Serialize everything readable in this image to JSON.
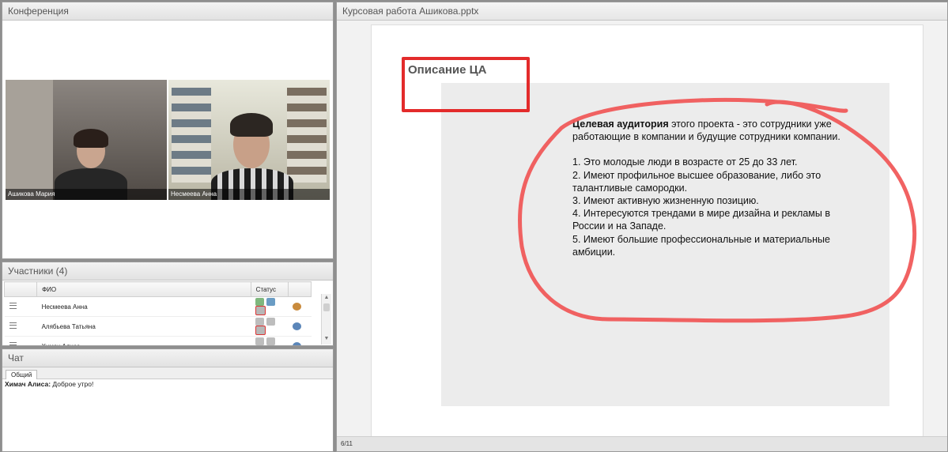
{
  "conference": {
    "title": "Конференция",
    "videos": [
      {
        "name": "Ашикова Мария"
      },
      {
        "name": "Несмеева Анна"
      }
    ]
  },
  "participants": {
    "title": "Участники (4)",
    "columns": {
      "name": "ФИО",
      "status": "Статус"
    },
    "rows": [
      {
        "name": "Несмеева Анна"
      },
      {
        "name": "Алябьева Татьяна"
      },
      {
        "name": "Химач Алиса"
      }
    ]
  },
  "chat": {
    "title": "Чат",
    "tab": "Общий",
    "messages": [
      {
        "user": "Химач Алиса:",
        "text": " Доброе утро!"
      }
    ]
  },
  "presentation": {
    "title": "Курсовая  работа Ашикова.pptx",
    "slide_title": "Описание  ЦА",
    "intro_bold": "Целевая аудитория",
    "intro_rest": " этого проекта  - это сотрудники  уже работающие  в компании  и будущие  сотрудники  компании.",
    "points": [
      "1. Это молодые люди  в возрасте от 25 до 33 лет.",
      "2. Имеют профильное высшее образование,  либо это талантливые  самородки.",
      "3. Имеют активную  жизненную позицию.",
      "4. Интересуются трендами в мире дизайна  и рекламы в России и на Западе.",
      "5. Имеют большие профессиональные  и материальные амбиции."
    ],
    "page_indicator": "6/11"
  },
  "colors": {
    "annotation": "#f05a5a",
    "title_box": "#e32b2b"
  }
}
